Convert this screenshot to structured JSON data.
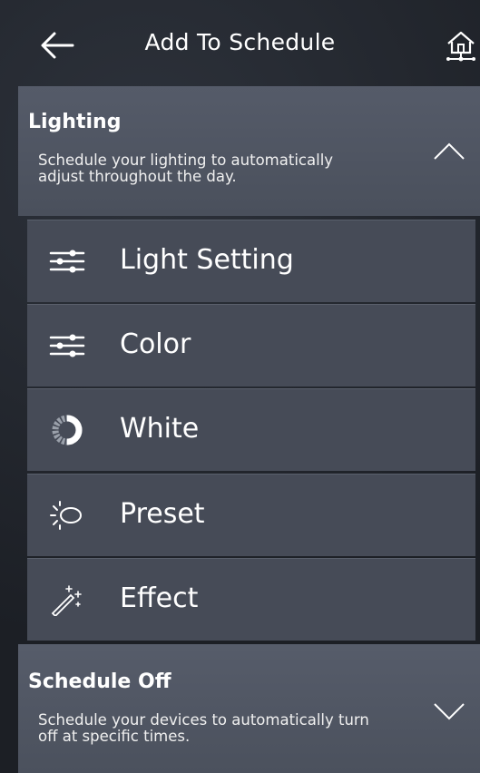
{
  "header": {
    "title": "Add To Schedule",
    "back_icon": "arrow-left-icon",
    "home_icon": "home-network-icon"
  },
  "lighting": {
    "title": "Lighting",
    "description": "Schedule your lighting to automatically adjust throughout the day.",
    "expanded": true,
    "items": [
      {
        "label": "Light Setting",
        "icon": "sliders-icon"
      },
      {
        "label": "Color",
        "icon": "sliders-icon"
      },
      {
        "label": "White",
        "icon": "white-temperature-ring-icon"
      },
      {
        "label": "Preset",
        "icon": "preset-bulb-icon"
      },
      {
        "label": "Effect",
        "icon": "magic-wand-icon"
      }
    ]
  },
  "schedule_off": {
    "title": "Schedule Off",
    "description": "Schedule your devices to automatically turn off at specific times.",
    "expanded": false
  },
  "colors": {
    "background": "#1f2228",
    "section": "#4a505d",
    "item": "#464b57",
    "text": "#ffffff"
  }
}
